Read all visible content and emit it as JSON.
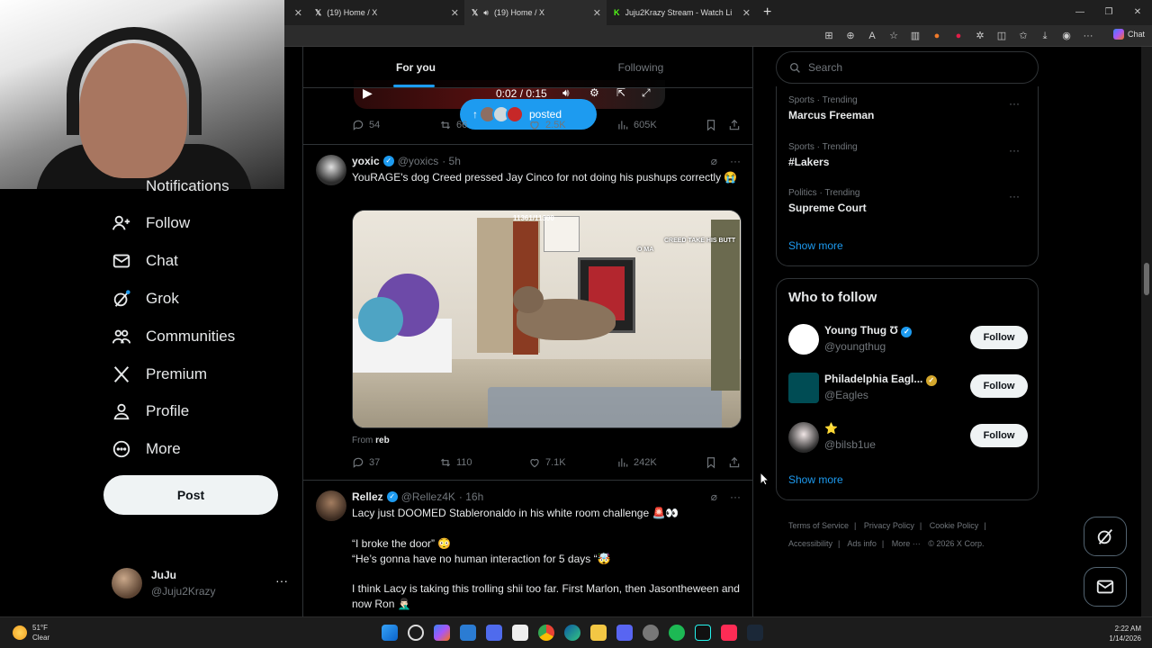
{
  "browser": {
    "tabs": [
      {
        "label": "(19) Home / X"
      },
      {
        "label": "(19) Home / X"
      },
      {
        "label": "Juju2Krazy Stream - Watch Live on"
      }
    ],
    "chat_label": "Chat"
  },
  "nav": {
    "items": [
      {
        "label": "Notifications"
      },
      {
        "label": "Follow"
      },
      {
        "label": "Chat"
      },
      {
        "label": "Grok"
      },
      {
        "label": "Communities"
      },
      {
        "label": "Premium"
      },
      {
        "label": "Profile"
      },
      {
        "label": "More"
      }
    ],
    "post_label": "Post",
    "account": {
      "name": "JuJu",
      "handle": "@Juju2Krazy"
    }
  },
  "feed": {
    "tabs": [
      "For you",
      "Following"
    ],
    "video": {
      "time": "0:02 / 0:15"
    },
    "new_posts_pill": "posted",
    "top_actions": {
      "replies": "54",
      "reposts": "66",
      "likes": "2.5K",
      "views": "605K"
    },
    "tweets": [
      {
        "name": "yoxic",
        "handle": "@yoxics",
        "time": "· 5h",
        "text": "YouRAGE's dog Creed pressed Jay Cinco for not doing his pushups correctly 😭",
        "media_overlay_counter": "11361/11300",
        "media_overlay_caption": "CREED TAKE HIS BUTT",
        "media_overlay_user": "O MA",
        "from_label": "From",
        "from_source": "reb",
        "actions": {
          "replies": "37",
          "reposts": "110",
          "likes": "7.1K",
          "views": "242K"
        }
      },
      {
        "name": "Rellez",
        "handle": "@Rellez4K",
        "time": "· 16h",
        "lines": [
          "Lacy just DOOMED Stableronaldo in his white room challenge 🚨👀",
          "“I broke the door” 😳",
          "“He’s gonna have no human interaction for 5 days “🤯",
          "I think Lacy is taking this trolling shii too far. First Marlon, then Jasontheween and now Ron 🤦🏻‍♂️"
        ]
      }
    ]
  },
  "sidebar": {
    "search_placeholder": "Search",
    "trends": [
      {
        "meta": "Sports · Trending",
        "title": "Marcus Freeman"
      },
      {
        "meta": "Sports · Trending",
        "title": "#Lakers"
      },
      {
        "meta": "Politics · Trending",
        "title": "Supreme Court"
      }
    ],
    "trends_show_more": "Show more",
    "who_to_follow": {
      "title": "Who to follow",
      "accounts": [
        {
          "name": "Young Thug Ʊ",
          "handle": "@youngthug"
        },
        {
          "name": "Philadelphia Eagl...",
          "handle": "@Eagles"
        },
        {
          "name": "⭐",
          "handle": "@bilsb1ue"
        }
      ],
      "follow_label": "Follow",
      "show_more": "Show more"
    },
    "footer": [
      "Terms of Service",
      "|",
      "Privacy Policy",
      "|",
      "Cookie Policy",
      "|",
      "Accessibility",
      "|",
      "Ads info",
      "|",
      "More ···",
      "© 2026 X Corp."
    ]
  },
  "taskbar": {
    "weather_temp": "51°F",
    "weather_desc": "Clear",
    "time": "2:22 AM",
    "date": "1/14/2026"
  },
  "colors": {
    "accent": "#1d9bf0",
    "background": "#000000",
    "border": "#2f3336",
    "muted": "#71767b"
  }
}
